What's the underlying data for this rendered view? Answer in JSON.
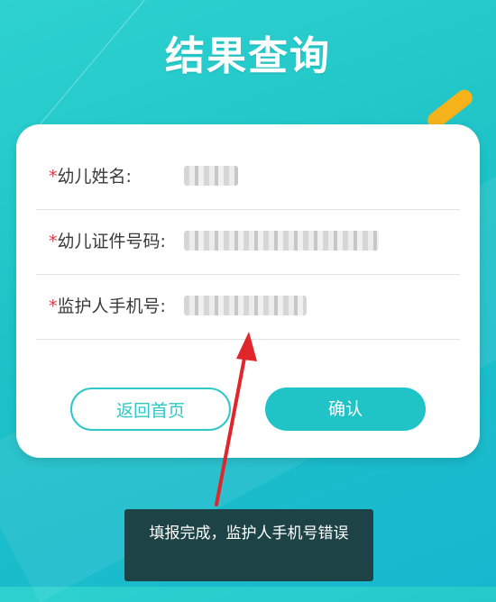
{
  "page": {
    "title": "结果查询"
  },
  "form": {
    "fields": [
      {
        "required_mark": "*",
        "label": "幼儿姓名:"
      },
      {
        "required_mark": "*",
        "label": "幼儿证件号码:"
      },
      {
        "required_mark": "*",
        "label": "监护人手机号:"
      }
    ]
  },
  "buttons": {
    "back_label": "返回首页",
    "confirm_label": "确认"
  },
  "toast": {
    "message": "填报完成，监护人手机号错误"
  },
  "colors": {
    "accent": "#20c3c6",
    "required": "#e0383e",
    "toast_bg": "#1e4347",
    "annotation_arrow": "#e0262b"
  },
  "icons": {
    "annotation": "red-arrow-icon"
  }
}
